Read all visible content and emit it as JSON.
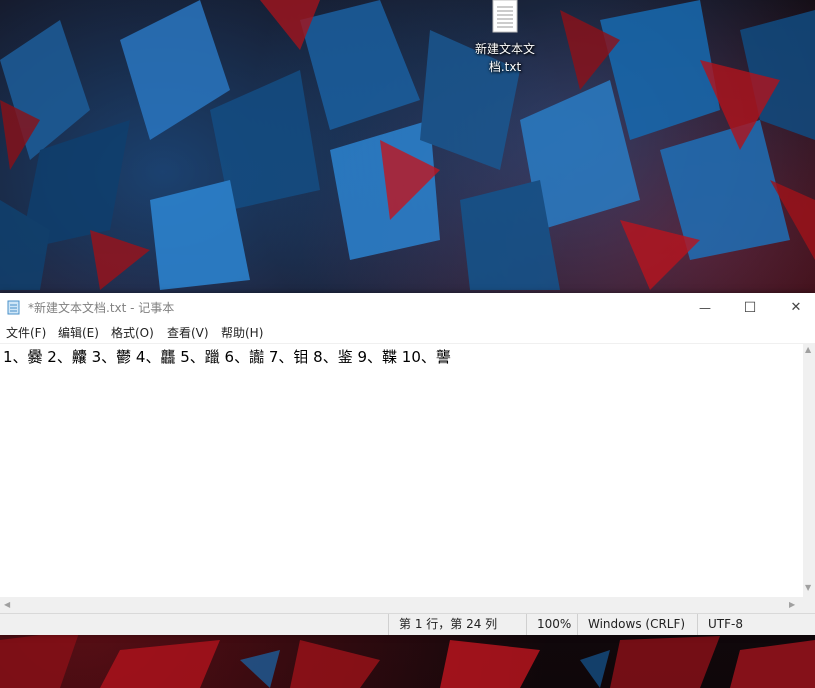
{
  "desktop": {
    "icons": [
      {
        "label_line1": "新建文本文",
        "label_line2": "档.txt"
      }
    ]
  },
  "window": {
    "title": "*新建文本文档.txt - 记事本",
    "controls": {
      "minimize": "—",
      "maximize": "☐",
      "close": "✕"
    },
    "menu": [
      "文件(F)",
      "编辑(E)",
      "格式(O)",
      "查看(V)",
      "帮助(H)"
    ],
    "content": "1、爨 2、齉 3、鬱 4、龘 5、躐 6、讟 7、钼 8、鉴 9、鞢 10、讋",
    "status": {
      "position": "第 1 行，第 24 列",
      "zoom": "100%",
      "line_ending": "Windows (CRLF)",
      "encoding": "UTF-8"
    }
  },
  "colors": {
    "accent_blue": "#1e6ebe",
    "accent_red": "#b4141e"
  }
}
